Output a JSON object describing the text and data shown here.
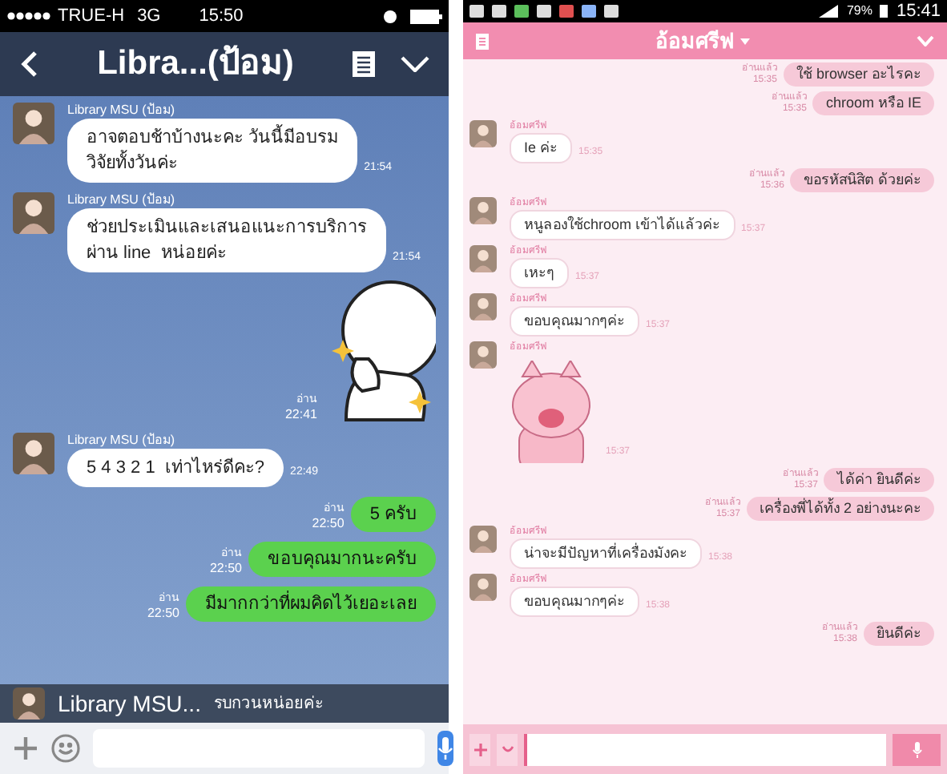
{
  "left_phone": {
    "status_bar": {
      "carrier": "TRUE-H",
      "network": "3G",
      "time": "15:50"
    },
    "header": {
      "title": "Libra...(ป้อม)"
    },
    "messages": [
      {
        "kind": "incoming",
        "sender": "Library MSU (ป้อม)",
        "text": "อาจตอบช้าบ้างนะคะ วันนี้มีอบรม\nวิจัยทั้งวันค่ะ",
        "time": "21:54"
      },
      {
        "kind": "incoming",
        "sender": "Library MSU (ป้อม)",
        "text": "ช่วยประเมินและเสนอแนะการบริการ\nผ่าน line  หน่อยค่ะ",
        "time": "21:54"
      },
      {
        "kind": "sticker",
        "read": "อ่าน",
        "time": "22:41"
      },
      {
        "kind": "incoming",
        "sender": "Library MSU (ป้อม)",
        "text": "5 4 3 2 1  เท่าไหร่ดีคะ?",
        "time": "22:49"
      },
      {
        "kind": "outgoing",
        "read": "อ่าน",
        "text": "5 ครับ",
        "time": "22:50"
      },
      {
        "kind": "outgoing",
        "read": "อ่าน",
        "text": "ขอบคุณมากนะครับ",
        "time": "22:50"
      },
      {
        "kind": "outgoing",
        "read": "อ่าน",
        "text": "มีมากกว่าที่ผมคิดไว้เยอะเลย",
        "time": "22:50"
      }
    ],
    "notification": {
      "sender": "Library MSU...",
      "text": "รบกวนหน่อยค่ะ"
    }
  },
  "right_phone": {
    "status_bar": {
      "battery": "79%",
      "time": "15:41"
    },
    "header": {
      "title": "อ้อมศรีฟ"
    },
    "messages": [
      {
        "kind": "outgoing",
        "read": "อ่านแล้ว",
        "text": "ใช้ browser อะไรคะ",
        "time": "15:35"
      },
      {
        "kind": "outgoing",
        "read": "อ่านแล้ว",
        "text": "chroom หรือ IE",
        "time": "15:35"
      },
      {
        "kind": "incoming",
        "sender": "อ้อมศรีฟ",
        "text": "Ie ค่ะ",
        "time": "15:35"
      },
      {
        "kind": "outgoing",
        "read": "อ่านแล้ว",
        "text": "ขอรหัสนิสิต ด้วยค่ะ",
        "time": "15:36"
      },
      {
        "kind": "incoming",
        "sender": "อ้อมศรีฟ",
        "text": "หนูลองใช้chroom เข้าได้แล้วค่ะ",
        "time": "15:37"
      },
      {
        "kind": "incoming",
        "sender": "อ้อมศรีฟ",
        "text": "เหะๆ",
        "time": "15:37"
      },
      {
        "kind": "incoming",
        "sender": "อ้อมศรีฟ",
        "text": "ขอบคุณมากๆค่ะ",
        "time": "15:37"
      },
      {
        "kind": "sticker",
        "sender": "อ้อมศรีฟ",
        "time": "15:37"
      },
      {
        "kind": "outgoing",
        "read": "อ่านแล้ว",
        "text": "ได้ค่า ยินดีค่ะ",
        "time": "15:37"
      },
      {
        "kind": "outgoing",
        "read": "อ่านแล้ว",
        "text": "เครื่องพี่ได้ทั้ง 2 อย่างนะคะ",
        "time": "15:37"
      },
      {
        "kind": "incoming",
        "sender": "อ้อมศรีฟ",
        "text": "น่าจะมีปัญหาที่เครื่องมังคะ",
        "time": "15:38"
      },
      {
        "kind": "incoming",
        "sender": "อ้อมศรีฟ",
        "text": "ขอบคุณมากๆค่ะ",
        "time": "15:38"
      },
      {
        "kind": "outgoing",
        "read": "อ่านแล้ว",
        "text": "ยินดีค่ะ",
        "time": "15:38"
      }
    ]
  }
}
